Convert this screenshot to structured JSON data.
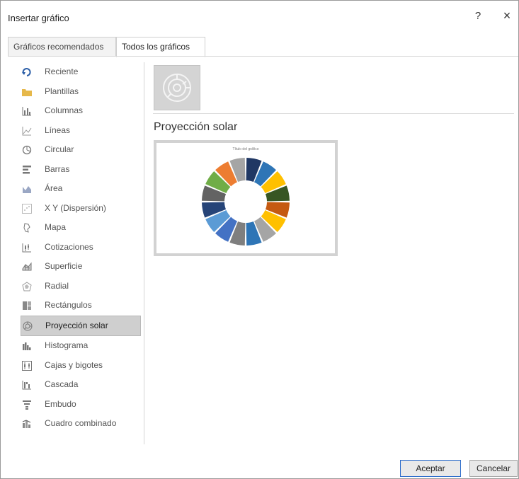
{
  "dialog": {
    "title": "Insertar gráfico",
    "help_label": "?",
    "close_label": "×"
  },
  "tabs": [
    {
      "label": "Gráficos recomendados"
    },
    {
      "label": "Todos los gráficos"
    }
  ],
  "sidebar": {
    "items": [
      {
        "label": "Reciente",
        "icon": "recent-icon"
      },
      {
        "label": "Plantillas",
        "icon": "folder-icon"
      },
      {
        "label": "Columnas",
        "icon": "column-chart-icon"
      },
      {
        "label": "Líneas",
        "icon": "line-chart-icon"
      },
      {
        "label": "Circular",
        "icon": "pie-chart-icon"
      },
      {
        "label": "Barras",
        "icon": "bar-chart-icon"
      },
      {
        "label": "Área",
        "icon": "area-chart-icon"
      },
      {
        "label": "X Y (Dispersión)",
        "icon": "scatter-chart-icon"
      },
      {
        "label": "Mapa",
        "icon": "map-chart-icon"
      },
      {
        "label": "Cotizaciones",
        "icon": "stock-chart-icon"
      },
      {
        "label": "Superficie",
        "icon": "surface-chart-icon"
      },
      {
        "label": "Radial",
        "icon": "radar-chart-icon"
      },
      {
        "label": "Rectángulos",
        "icon": "treemap-chart-icon"
      },
      {
        "label": "Proyección solar",
        "icon": "sunburst-chart-icon",
        "selected": true
      },
      {
        "label": "Histograma",
        "icon": "histogram-chart-icon"
      },
      {
        "label": "Cajas y bigotes",
        "icon": "box-whisker-chart-icon"
      },
      {
        "label": "Cascada",
        "icon": "waterfall-chart-icon"
      },
      {
        "label": "Embudo",
        "icon": "funnel-chart-icon"
      },
      {
        "label": "Cuadro combinado",
        "icon": "combo-chart-icon"
      }
    ]
  },
  "main": {
    "chart_name": "Proyección solar",
    "preview_title": "Título del gráfico"
  },
  "footer": {
    "ok_label": "Aceptar",
    "cancel_label": "Cancelar"
  },
  "colors": {
    "accent": "#2b6ccb",
    "selected_bg": "#cfcfcf",
    "icon_gray": "#8a8a8a"
  },
  "sunburst_colors": [
    "#203864",
    "#2e75b6",
    "#ffc000",
    "#375623",
    "#c55a11",
    "#ffc000",
    "#a5a5a5",
    "#2e75b6",
    "#7f7f7f",
    "#4472c4",
    "#5b9bd5",
    "#264478",
    "#636363",
    "#70ad47",
    "#ed7d31",
    "#a5a5a5"
  ]
}
